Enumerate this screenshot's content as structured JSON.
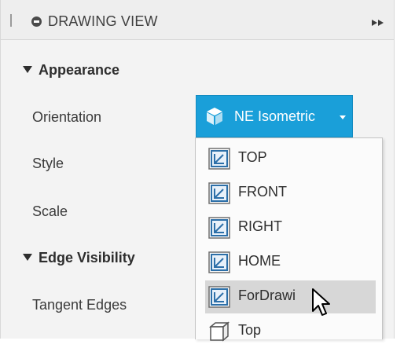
{
  "panel": {
    "title": "DRAWING VIEW"
  },
  "sections": {
    "appearance": "Appearance",
    "edge_visibility": "Edge Visibility"
  },
  "labels": {
    "orientation": "Orientation",
    "style": "Style",
    "scale": "Scale",
    "tangent_edges": "Tangent Edges"
  },
  "orientation": {
    "selected": "NE Isometric",
    "icon": "isometric-cube-icon"
  },
  "menu": {
    "items": [
      {
        "label": "TOP",
        "icon": "named-view-icon"
      },
      {
        "label": "FRONT",
        "icon": "named-view-icon"
      },
      {
        "label": "RIGHT",
        "icon": "named-view-icon"
      },
      {
        "label": "HOME",
        "icon": "named-view-icon"
      },
      {
        "label": "ForDrawi",
        "icon": "named-view-icon",
        "hovered": true
      },
      {
        "label": "Top",
        "icon": "view-cube-icon"
      }
    ]
  },
  "colors": {
    "accent": "#1a9fd9",
    "hover": "#d7d7d7",
    "icon_blue": "#2c6fa8"
  }
}
